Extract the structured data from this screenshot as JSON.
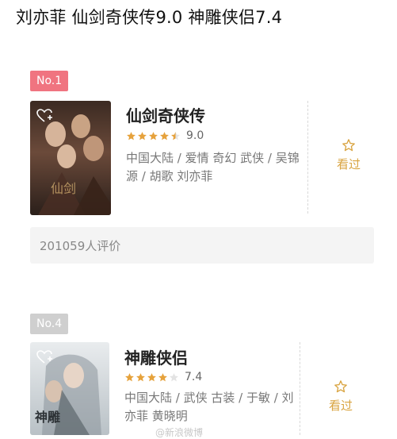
{
  "header": {
    "text": "刘亦菲  仙剑奇侠传9.0   神雕侠侣7.4"
  },
  "colors": {
    "rank1_badge": "#f07480",
    "rank2_badge": "#cfcfcf",
    "star": "#e6a23c",
    "seen": "#d9a441"
  },
  "entries": [
    {
      "rank": "No.1",
      "title": "仙剑奇侠传",
      "stars": 4.5,
      "score": "9.0",
      "meta": "中国大陆 / 爱情 奇幻 武侠 / 吴锦源 / 胡歌 刘亦菲",
      "seen_label": "看过",
      "rating_count": "201059人评价"
    },
    {
      "rank": "No.4",
      "title": "神雕侠侣",
      "stars": 4,
      "score": "7.4",
      "meta": "中国大陆 / 武侠 古装 / 于敏 / 刘亦菲 黄晓明",
      "seen_label": "看过"
    }
  ],
  "watermark": "@新浪微博"
}
